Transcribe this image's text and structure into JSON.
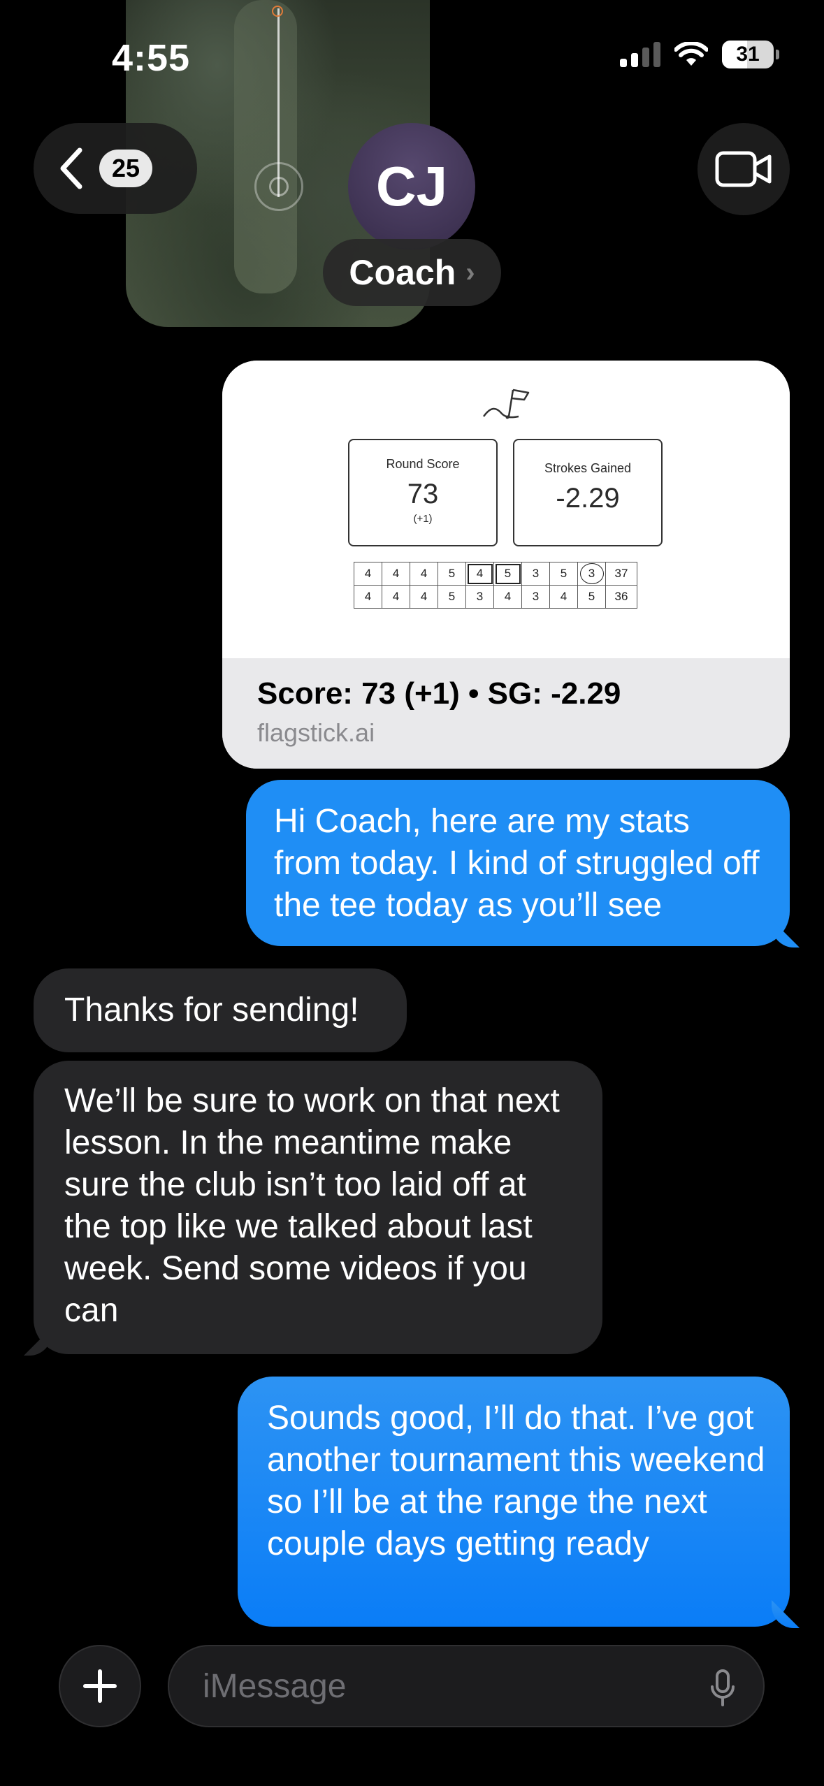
{
  "status_bar": {
    "time": "4:55",
    "battery": "31"
  },
  "header": {
    "back_count": "25",
    "avatar_initials": "CJ",
    "contact_name": "Coach"
  },
  "link_card": {
    "round_score_label": "Round Score",
    "round_score": "73",
    "round_score_sub": "(+1)",
    "strokes_gained_label": "Strokes Gained",
    "strokes_gained": "-2.29",
    "scorecard": [
      [
        "4",
        "4",
        "4",
        "5",
        "4",
        "5",
        "3",
        "5",
        "3",
        "37"
      ],
      [
        "4",
        "4",
        "4",
        "5",
        "3",
        "4",
        "3",
        "4",
        "5",
        "36"
      ]
    ],
    "title": "Score: 73 (+1) • SG: -2.29",
    "domain": "flagstick.ai"
  },
  "messages": [
    {
      "from": "me",
      "text": "Hi Coach, here are my stats from today. I kind of struggled off the tee today as you’ll see"
    },
    {
      "from": "them",
      "text": "Thanks for sending!"
    },
    {
      "from": "them",
      "text": "We’ll be sure to work on that next lesson. In the meantime make sure the club isn’t too laid off at the top like we talked about last week. Send some videos if you can"
    },
    {
      "from": "me",
      "text": "Sounds good, I’ll do that. I’ve got another tournament this weekend so I’ll be at the range the next couple days getting ready"
    }
  ],
  "composer": {
    "placeholder": "iMessage"
  },
  "colors": {
    "sent_bubble": "#1f8ef5",
    "received_bubble": "#262628",
    "background": "#000000"
  }
}
